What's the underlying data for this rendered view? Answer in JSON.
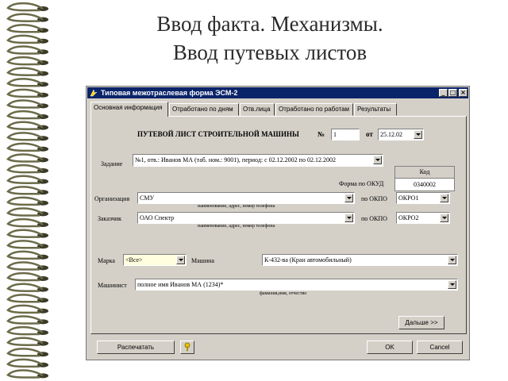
{
  "slide": {
    "title_line1": "Ввод факта. Механизмы.",
    "title_line2": "Ввод путевых листов"
  },
  "window": {
    "title": "Типовая межотраслевая форма ЭСМ-2",
    "controls": {
      "minimize": "_",
      "maximize": "□",
      "close": "×"
    }
  },
  "tabs": [
    {
      "label": "Основная информация",
      "active": true
    },
    {
      "label": "Отработано по дням"
    },
    {
      "label": "Отв.лица"
    },
    {
      "label": "Отработано по работам"
    },
    {
      "label": "Результаты"
    }
  ],
  "form": {
    "header": "ПУТЕВОЙ ЛИСТ СТРОИТЕЛЬНОЙ МАШИНЫ",
    "number_label": "№",
    "number_value": "1",
    "date_label": "от",
    "date_value": "25.12.02",
    "task_label": "Задание",
    "task_value": "№1, отв.: Иванов МА (таб. ном.: 9001), период: с 02.12.2002 по 02.12.2002",
    "kod_header": "Код",
    "okud_label": "Форма по ОКУД",
    "okud_value": "0340002",
    "org_label": "Организация",
    "org_value": "СМУ",
    "org_hint": "наименование, адрес, номер телефона",
    "org_okpo_label": "по ОКПО",
    "org_okpo_value": "ОКРО1",
    "customer_label": "Заказчик",
    "customer_value": "ОАО Спектр",
    "customer_hint": "наименование, адрес, номер телефона",
    "customer_okpo_label": "по ОКПО",
    "customer_okpo_value": "ОКРО2",
    "brand_label": "Марка",
    "brand_value": "<Все>",
    "machine_label": "Машина",
    "machine_value": "К-432-ва (Кран автомобильный)",
    "operator_label": "Машинист",
    "operator_value": "полное имя Иванов МА (1234)*",
    "operator_hint": "фамилия,имя, отчество",
    "next_button": "Дальше >>"
  },
  "footer": {
    "print_button": "Распечатать",
    "ok_button": "OK",
    "cancel_button": "Cancel"
  },
  "colors": {
    "titlebar": "#0a246a",
    "window_bg": "#d4d0c8",
    "field_highlight": "#ffffe0",
    "spiral_ring": "#6b6b4a"
  },
  "icons": {
    "window_icon": "arrow-app-icon",
    "help_icon": "key-help-icon",
    "binding": "spiral-binding-icon"
  }
}
